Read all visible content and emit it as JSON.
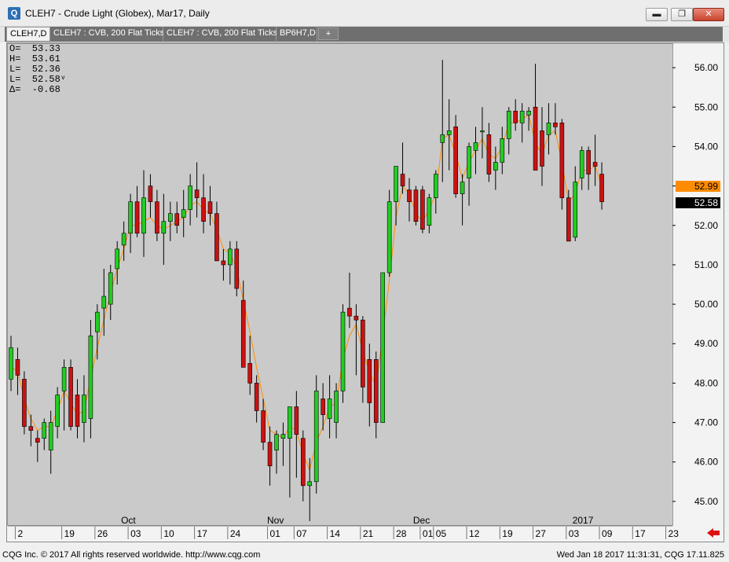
{
  "window": {
    "icon": "Q",
    "title": "CLEH7 - Crude Light (Globex), Mar17, Daily",
    "minimize": "▬",
    "restore": "❐",
    "close": "✕"
  },
  "tabs": [
    {
      "label": "CLEH7,D",
      "active": true
    },
    {
      "label": "CLEH7 : CVB, 200 Flat Ticks",
      "active": false
    },
    {
      "label": "CLEH7 : CVB, 200 Flat Ticks",
      "active": false
    },
    {
      "label": "BP6H7,D",
      "active": false
    }
  ],
  "tab_add": "+",
  "ohlc": {
    "open": "O=  53.33",
    "high": "H=  53.61",
    "low": "L=  52.36",
    "last": "L=  52.58ᵛ",
    "change": "Δ=  -0.68"
  },
  "price_tags": {
    "orange": {
      "value": "52.99",
      "price": 52.99,
      "color": "#ff8c00"
    },
    "black": {
      "value": "52.58",
      "price": 52.58,
      "color": "#000000"
    }
  },
  "footer": {
    "left": "CQG Inc. © 2017 All rights reserved worldwide. http://www.cqg.com",
    "right": "Wed Jan 18 2017 11:31:31,  CQG 17.11.825"
  },
  "chart_data": {
    "type": "candlestick",
    "ylim": [
      44.4,
      56.6
    ],
    "yticks": [
      "45.00",
      "46.00",
      "47.00",
      "48.00",
      "49.00",
      "50.00",
      "51.00",
      "52.00",
      "53.00",
      "54.00",
      "55.00",
      "56.00"
    ],
    "x_day_labels": [
      "2",
      "19",
      "26",
      "03",
      "10",
      "17",
      "24",
      "01",
      "07",
      "14",
      "21",
      "28",
      "01",
      "05",
      "12",
      "19",
      "27",
      "03",
      "09",
      "17",
      "23"
    ],
    "x_day_label_index": [
      1,
      8,
      13,
      18,
      23,
      28,
      33,
      39,
      43,
      48,
      53,
      58,
      62,
      64,
      69,
      74,
      79,
      84,
      89,
      94,
      99
    ],
    "x_month_labels": [
      "Oct",
      "Nov",
      "Dec",
      "2017"
    ],
    "x_month_label_index": [
      18,
      40,
      62,
      86
    ],
    "colors": {
      "up": "#22cc22",
      "down": "#cc1111",
      "ma": "#ff8c00",
      "bg": "#cacaca"
    },
    "candles": [
      {
        "o": 48.1,
        "h": 49.2,
        "l": 47.8,
        "c": 48.9
      },
      {
        "o": 48.6,
        "h": 48.9,
        "l": 47.7,
        "c": 48.2
      },
      {
        "o": 48.1,
        "h": 48.3,
        "l": 46.7,
        "c": 46.9
      },
      {
        "o": 46.9,
        "h": 47.2,
        "l": 46.4,
        "c": 46.8
      },
      {
        "o": 46.6,
        "h": 46.8,
        "l": 46.0,
        "c": 46.5
      },
      {
        "o": 46.6,
        "h": 47.1,
        "l": 46.3,
        "c": 47.0
      },
      {
        "o": 46.3,
        "h": 47.3,
        "l": 45.7,
        "c": 47.0
      },
      {
        "o": 46.9,
        "h": 47.9,
        "l": 46.6,
        "c": 47.7
      },
      {
        "o": 47.8,
        "h": 48.6,
        "l": 46.8,
        "c": 48.4
      },
      {
        "o": 48.4,
        "h": 48.6,
        "l": 46.8,
        "c": 46.9
      },
      {
        "o": 47.7,
        "h": 48.1,
        "l": 46.6,
        "c": 46.9
      },
      {
        "o": 47.0,
        "h": 48.2,
        "l": 46.5,
        "c": 47.7
      },
      {
        "o": 47.1,
        "h": 49.6,
        "l": 46.6,
        "c": 49.2
      },
      {
        "o": 49.3,
        "h": 50.0,
        "l": 48.6,
        "c": 49.8
      },
      {
        "o": 49.9,
        "h": 50.9,
        "l": 49.2,
        "c": 50.2
      },
      {
        "o": 50.0,
        "h": 51.0,
        "l": 49.6,
        "c": 50.8
      },
      {
        "o": 50.9,
        "h": 51.6,
        "l": 50.5,
        "c": 51.4
      },
      {
        "o": 51.5,
        "h": 52.1,
        "l": 51.1,
        "c": 51.8
      },
      {
        "o": 51.8,
        "h": 52.8,
        "l": 51.3,
        "c": 52.6
      },
      {
        "o": 52.6,
        "h": 53.0,
        "l": 51.7,
        "c": 51.8
      },
      {
        "o": 51.8,
        "h": 53.4,
        "l": 51.2,
        "c": 52.7
      },
      {
        "o": 53.0,
        "h": 53.3,
        "l": 52.2,
        "c": 52.6
      },
      {
        "o": 52.6,
        "h": 52.9,
        "l": 51.6,
        "c": 51.8
      },
      {
        "o": 51.8,
        "h": 52.8,
        "l": 51.0,
        "c": 52.1
      },
      {
        "o": 52.1,
        "h": 52.6,
        "l": 51.6,
        "c": 52.3
      },
      {
        "o": 52.3,
        "h": 52.6,
        "l": 51.8,
        "c": 52.0
      },
      {
        "o": 52.2,
        "h": 52.9,
        "l": 51.7,
        "c": 52.4
      },
      {
        "o": 52.4,
        "h": 53.3,
        "l": 52.0,
        "c": 53.0
      },
      {
        "o": 52.9,
        "h": 53.6,
        "l": 52.2,
        "c": 52.7
      },
      {
        "o": 52.7,
        "h": 53.3,
        "l": 51.8,
        "c": 52.1
      },
      {
        "o": 52.6,
        "h": 53.0,
        "l": 52.0,
        "c": 52.3
      },
      {
        "o": 52.3,
        "h": 52.6,
        "l": 51.1,
        "c": 51.1
      },
      {
        "o": 51.1,
        "h": 51.4,
        "l": 50.6,
        "c": 51.0
      },
      {
        "o": 51.0,
        "h": 51.6,
        "l": 50.5,
        "c": 51.4
      },
      {
        "o": 51.4,
        "h": 51.6,
        "l": 50.2,
        "c": 50.4
      },
      {
        "o": 50.1,
        "h": 50.6,
        "l": 48.4,
        "c": 48.4
      },
      {
        "o": 48.5,
        "h": 49.2,
        "l": 47.7,
        "c": 48.0
      },
      {
        "o": 48.0,
        "h": 48.2,
        "l": 47.0,
        "c": 47.3
      },
      {
        "o": 47.3,
        "h": 47.6,
        "l": 46.3,
        "c": 46.5
      },
      {
        "o": 46.5,
        "h": 46.9,
        "l": 45.4,
        "c": 45.9
      },
      {
        "o": 46.3,
        "h": 46.8,
        "l": 45.7,
        "c": 46.7
      },
      {
        "o": 46.6,
        "h": 47.0,
        "l": 45.9,
        "c": 46.7
      },
      {
        "o": 46.6,
        "h": 47.3,
        "l": 45.1,
        "c": 47.4
      },
      {
        "o": 47.4,
        "h": 47.8,
        "l": 45.6,
        "c": 46.7
      },
      {
        "o": 46.6,
        "h": 46.8,
        "l": 45.0,
        "c": 45.4
      },
      {
        "o": 45.4,
        "h": 46.1,
        "l": 44.5,
        "c": 45.5
      },
      {
        "o": 45.5,
        "h": 48.2,
        "l": 45.2,
        "c": 47.8
      },
      {
        "o": 47.6,
        "h": 48.0,
        "l": 46.8,
        "c": 47.2
      },
      {
        "o": 47.1,
        "h": 48.2,
        "l": 46.6,
        "c": 47.6
      },
      {
        "o": 47.0,
        "h": 48.0,
        "l": 46.6,
        "c": 47.8
      },
      {
        "o": 47.8,
        "h": 50.0,
        "l": 47.5,
        "c": 49.8
      },
      {
        "o": 49.9,
        "h": 50.8,
        "l": 49.4,
        "c": 49.7
      },
      {
        "o": 49.7,
        "h": 50.0,
        "l": 48.2,
        "c": 49.6
      },
      {
        "o": 49.6,
        "h": 49.7,
        "l": 47.5,
        "c": 47.9
      },
      {
        "o": 48.6,
        "h": 49.0,
        "l": 46.9,
        "c": 47.5
      },
      {
        "o": 48.6,
        "h": 48.8,
        "l": 46.6,
        "c": 47.0
      },
      {
        "o": 47.0,
        "h": 50.8,
        "l": 47.0,
        "c": 50.8
      },
      {
        "o": 50.8,
        "h": 52.9,
        "l": 50.7,
        "c": 52.6
      },
      {
        "o": 52.6,
        "h": 53.5,
        "l": 52.0,
        "c": 53.5
      },
      {
        "o": 53.3,
        "h": 54.1,
        "l": 52.8,
        "c": 53.0
      },
      {
        "o": 52.9,
        "h": 53.2,
        "l": 52.1,
        "c": 52.6
      },
      {
        "o": 52.9,
        "h": 53.0,
        "l": 52.0,
        "c": 52.1
      },
      {
        "o": 52.9,
        "h": 53.0,
        "l": 51.8,
        "c": 51.9
      },
      {
        "o": 52.0,
        "h": 52.8,
        "l": 51.8,
        "c": 52.7
      },
      {
        "o": 52.7,
        "h": 53.4,
        "l": 52.3,
        "c": 53.3
      },
      {
        "o": 54.1,
        "h": 56.2,
        "l": 53.1,
        "c": 54.3
      },
      {
        "o": 54.3,
        "h": 55.2,
        "l": 53.4,
        "c": 54.4
      },
      {
        "o": 54.5,
        "h": 54.8,
        "l": 52.7,
        "c": 52.8
      },
      {
        "o": 52.8,
        "h": 53.3,
        "l": 52.0,
        "c": 53.1
      },
      {
        "o": 53.2,
        "h": 54.1,
        "l": 52.5,
        "c": 54.0
      },
      {
        "o": 53.9,
        "h": 54.5,
        "l": 53.3,
        "c": 54.1
      },
      {
        "o": 54.4,
        "h": 55.0,
        "l": 53.7,
        "c": 54.4
      },
      {
        "o": 54.3,
        "h": 54.6,
        "l": 53.1,
        "c": 53.3
      },
      {
        "o": 53.4,
        "h": 54.0,
        "l": 52.9,
        "c": 53.6
      },
      {
        "o": 53.6,
        "h": 54.5,
        "l": 53.3,
        "c": 54.2
      },
      {
        "o": 54.2,
        "h": 55.0,
        "l": 53.8,
        "c": 54.9
      },
      {
        "o": 54.9,
        "h": 55.2,
        "l": 54.4,
        "c": 54.6
      },
      {
        "o": 54.6,
        "h": 55.1,
        "l": 54.1,
        "c": 54.9
      },
      {
        "o": 54.8,
        "h": 55.0,
        "l": 54.4,
        "c": 54.9
      },
      {
        "o": 55.0,
        "h": 56.1,
        "l": 53.4,
        "c": 53.4
      },
      {
        "o": 54.4,
        "h": 55.0,
        "l": 53.0,
        "c": 53.5
      },
      {
        "o": 54.3,
        "h": 55.1,
        "l": 53.8,
        "c": 54.6
      },
      {
        "o": 54.6,
        "h": 55.1,
        "l": 54.3,
        "c": 54.5
      },
      {
        "o": 54.6,
        "h": 54.7,
        "l": 52.4,
        "c": 52.7
      },
      {
        "o": 52.7,
        "h": 52.9,
        "l": 51.6,
        "c": 51.6
      },
      {
        "o": 51.7,
        "h": 53.5,
        "l": 51.6,
        "c": 53.1
      },
      {
        "o": 53.2,
        "h": 54.0,
        "l": 52.9,
        "c": 53.9
      },
      {
        "o": 53.9,
        "h": 54.0,
        "l": 52.9,
        "c": 53.3
      },
      {
        "o": 53.6,
        "h": 54.3,
        "l": 53.0,
        "c": 53.5
      },
      {
        "o": 53.3,
        "h": 53.6,
        "l": 52.4,
        "c": 52.6
      }
    ],
    "ma": [
      48.4,
      48.3,
      47.6,
      47.1,
      46.8,
      46.9,
      46.9,
      47.3,
      47.8,
      47.5,
      47.2,
      47.3,
      48.1,
      48.9,
      49.6,
      50.3,
      50.9,
      51.4,
      52.0,
      52.0,
      52.1,
      52.2,
      52.0,
      51.9,
      52.0,
      52.1,
      52.2,
      52.5,
      52.6,
      52.4,
      52.3,
      51.9,
      51.4,
      51.3,
      50.9,
      50.1,
      49.3,
      48.4,
      47.6,
      46.8,
      46.7,
      46.6,
      46.9,
      46.8,
      46.2,
      45.8,
      46.5,
      46.9,
      47.4,
      47.5,
      48.6,
      49.2,
      49.5,
      48.8,
      48.3,
      47.9,
      49.2,
      50.6,
      52.2,
      53.0,
      52.8,
      52.3,
      52.1,
      52.4,
      52.8,
      54.2,
      54.3,
      53.8,
      53.2,
      53.6,
      53.9,
      54.2,
      53.8,
      53.7,
      54.0,
      54.6,
      54.6,
      54.7,
      54.8,
      54.1,
      53.8,
      54.3,
      54.4,
      53.6,
      52.6,
      52.8,
      53.4,
      53.4,
      53.5,
      53.0
    ]
  }
}
